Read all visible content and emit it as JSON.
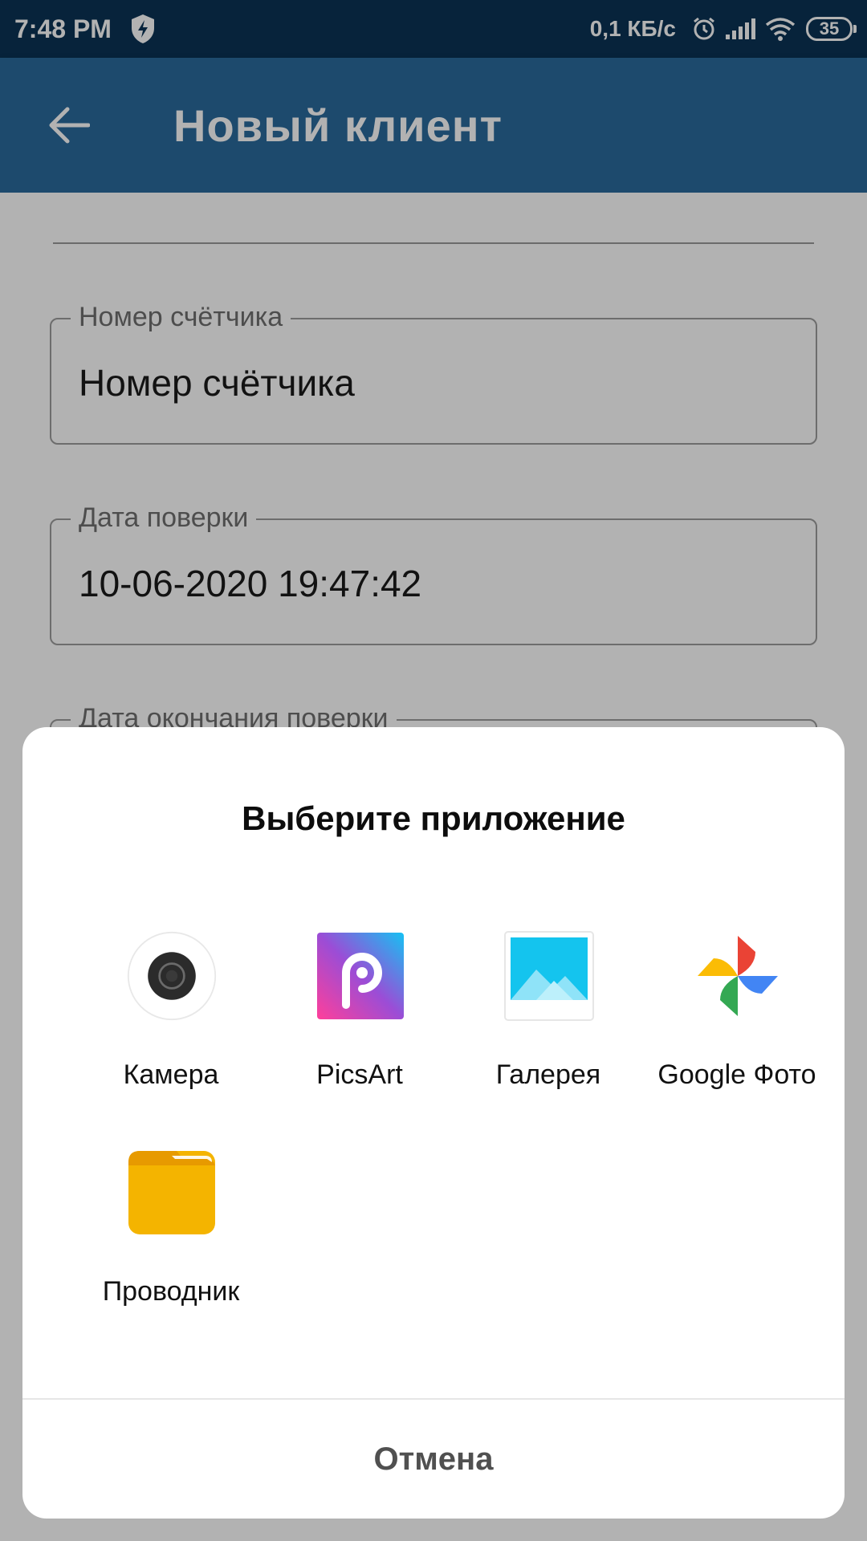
{
  "status_bar": {
    "time": "7:48 PM",
    "net_speed": "0,1 КБ/с",
    "battery": "35",
    "icons": [
      "shield-icon",
      "alarm-icon",
      "signal-icon",
      "wifi-icon",
      "battery-icon"
    ]
  },
  "app_bar": {
    "title": "Новый клиент",
    "back_icon": "arrow-left-icon"
  },
  "form": {
    "fields": [
      {
        "label": "Номер счётчика",
        "value": "Номер счётчика"
      },
      {
        "label": "Дата поверки",
        "value": "10-06-2020 19:47:42"
      },
      {
        "label": "Дата окончания поверки",
        "value": ""
      }
    ]
  },
  "chooser": {
    "title": "Выберите приложение",
    "apps": [
      {
        "label": "Камера",
        "icon": "camera-icon"
      },
      {
        "label": "PicsArt",
        "icon": "picsart-icon"
      },
      {
        "label": "Галерея",
        "icon": "gallery-icon"
      },
      {
        "label": "Google Фото",
        "icon": "google-photos-icon"
      },
      {
        "label": "Проводник",
        "icon": "folder-icon"
      }
    ],
    "cancel_label": "Отмена"
  },
  "colors": {
    "status_bar": "#0b3355",
    "app_bar": "#2a6a9c",
    "folder": "#f4b400"
  }
}
